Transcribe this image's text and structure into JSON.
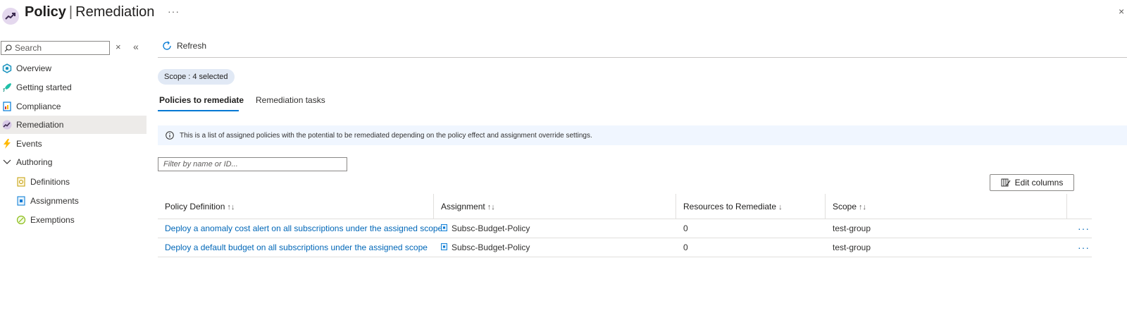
{
  "header": {
    "title": "Policy",
    "separator": "|",
    "subtitle": "Remediation",
    "more": "···",
    "close": "×"
  },
  "sidebar": {
    "search_placeholder": "Search",
    "clear": "×",
    "collapse": "«",
    "items": [
      {
        "label": "Overview",
        "icon": "overview-icon"
      },
      {
        "label": "Getting started",
        "icon": "rocket-icon"
      },
      {
        "label": "Compliance",
        "icon": "compliance-icon"
      },
      {
        "label": "Remediation",
        "icon": "remediation-icon",
        "selected": true
      },
      {
        "label": "Events",
        "icon": "lightning-icon"
      },
      {
        "label": "Authoring",
        "icon": "chevron-down-icon"
      },
      {
        "label": "Definitions",
        "icon": "definitions-icon"
      },
      {
        "label": "Assignments",
        "icon": "assignments-icon"
      },
      {
        "label": "Exemptions",
        "icon": "exemptions-icon"
      }
    ]
  },
  "toolbar": {
    "refresh_label": "Refresh"
  },
  "scope": {
    "label": "Scope : 4 selected"
  },
  "tabs": [
    {
      "label": "Policies to remediate",
      "active": true
    },
    {
      "label": "Remediation tasks",
      "active": false
    }
  ],
  "info": {
    "text": "This is a list of assigned policies with the potential to be remediated depending on the policy effect and assignment override settings."
  },
  "filter": {
    "placeholder": "Filter by name or ID..."
  },
  "edit_columns": {
    "label": "Edit columns"
  },
  "table": {
    "columns": [
      {
        "label": "Policy Definition",
        "sort": "↑↓"
      },
      {
        "label": "Assignment",
        "sort": "↑↓"
      },
      {
        "label": "Resources to Remediate",
        "sort": "↓"
      },
      {
        "label": "Scope",
        "sort": "↑↓"
      }
    ],
    "rows": [
      {
        "policy": "Deploy a anomaly cost alert on all subscriptions under the assigned scope",
        "assignment": "Subsc-Budget-Policy",
        "resources": "0",
        "scope": "test-group",
        "more": "···"
      },
      {
        "policy": "Deploy a default budget on all subscriptions under the assigned scope",
        "assignment": "Subsc-Budget-Policy",
        "resources": "0",
        "scope": "test-group",
        "more": "···"
      }
    ]
  },
  "colors": {
    "accent": "#0078d4",
    "link": "#0067b8",
    "selected_bg": "#edebe9",
    "info_bg": "#f0f6ff"
  }
}
